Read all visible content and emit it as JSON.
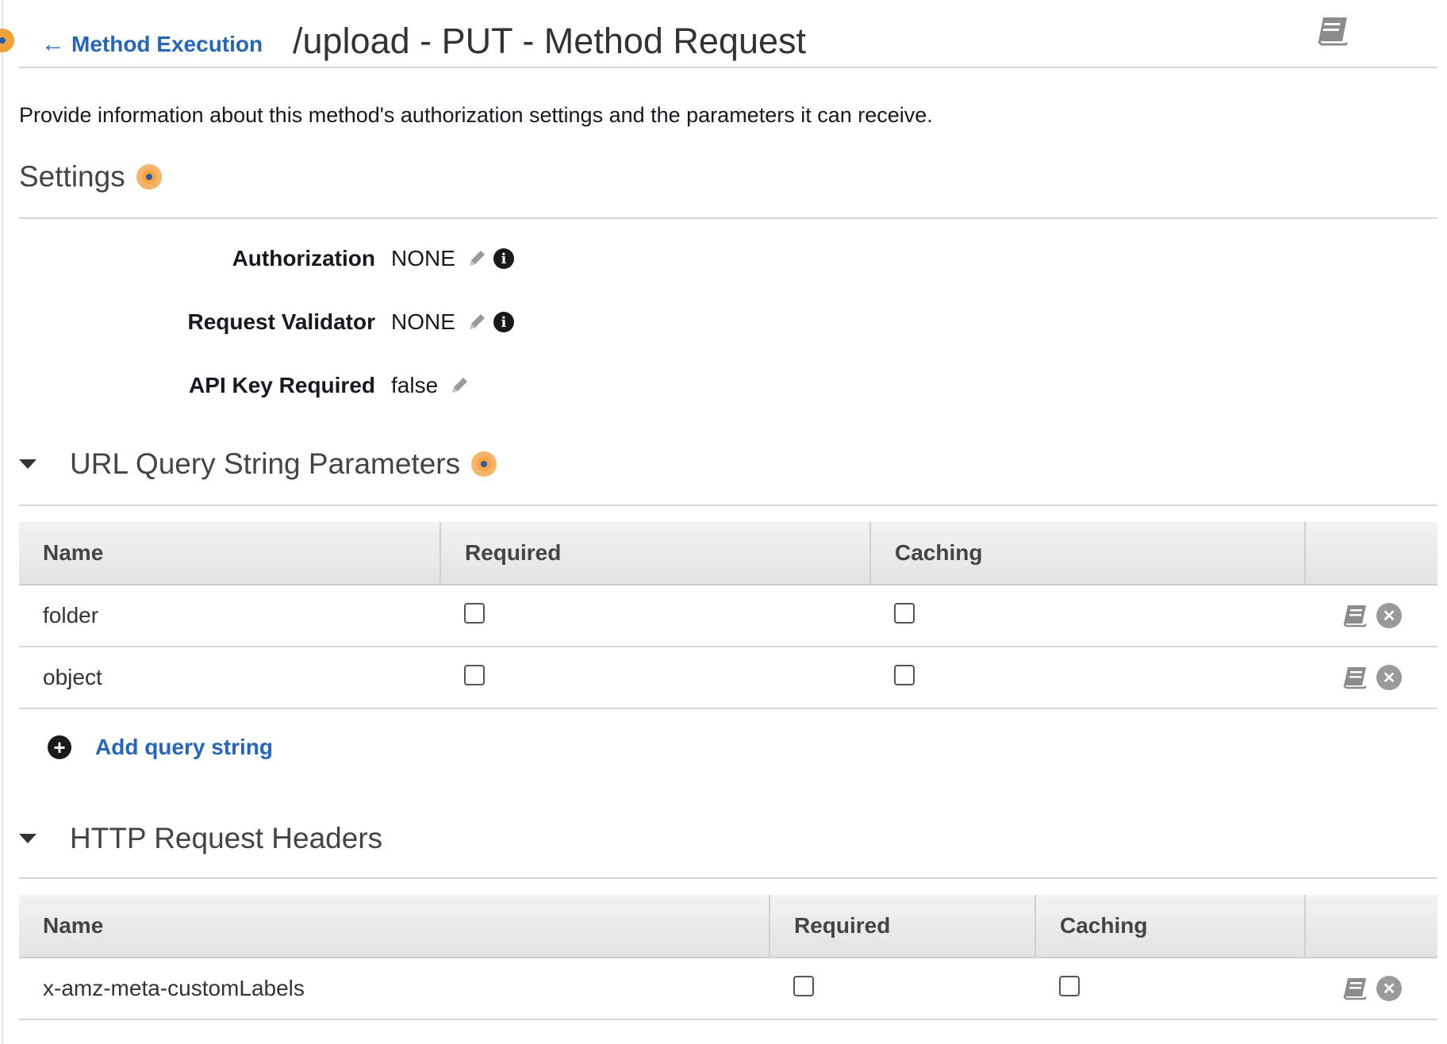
{
  "header": {
    "back_label": "Method Execution",
    "title": "/upload - PUT - Method Request"
  },
  "intro": "Provide information about this method's authorization settings and the parameters it can receive.",
  "settings": {
    "title": "Settings",
    "rows": [
      {
        "label": "Authorization",
        "value": "NONE"
      },
      {
        "label": "Request Validator",
        "value": "NONE"
      },
      {
        "label": "API Key Required",
        "value": "false"
      }
    ]
  },
  "query_params": {
    "title": "URL Query String Parameters",
    "columns": [
      "Name",
      "Required",
      "Caching"
    ],
    "rows": [
      {
        "name": "folder",
        "required": false,
        "caching": false
      },
      {
        "name": "object",
        "required": false,
        "caching": false
      }
    ],
    "add_label": "Add query string"
  },
  "headers": {
    "title": "HTTP Request Headers",
    "columns": [
      "Name",
      "Required",
      "Caching"
    ],
    "rows": [
      {
        "name": "x-amz-meta-customLabels",
        "required": false,
        "caching": false
      }
    ]
  },
  "colors": {
    "link": "#2566b8",
    "accent_dot": "#f6a441"
  }
}
